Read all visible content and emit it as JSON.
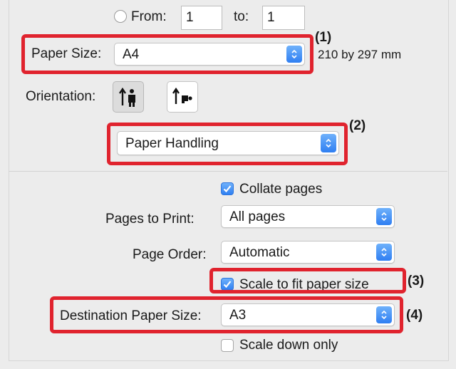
{
  "range": {
    "from_label": "From:",
    "from_value": "1",
    "to_label": "to:",
    "to_value": "1"
  },
  "paper_size": {
    "label": "Paper Size:",
    "value": "A4",
    "dimensions": "210 by 297 mm"
  },
  "orientation": {
    "label": "Orientation:",
    "selected": "portrait",
    "options": [
      "portrait",
      "landscape"
    ]
  },
  "section_menu": {
    "value": "Paper Handling"
  },
  "collate": {
    "label": "Collate pages",
    "checked": true
  },
  "pages_to_print": {
    "label": "Pages to Print:",
    "value": "All pages"
  },
  "page_order": {
    "label": "Page Order:",
    "value": "Automatic"
  },
  "scale_to_fit": {
    "label": "Scale to fit paper size",
    "checked": true
  },
  "destination": {
    "label": "Destination Paper Size:",
    "value": "A3"
  },
  "scale_down": {
    "label": "Scale down only",
    "checked": false
  },
  "callouts": [
    "(1)",
    "(2)",
    "(3)",
    "(4)"
  ],
  "colors": {
    "accent": "#2f7ff2",
    "highlight": "#e0232e",
    "background": "#ececec"
  }
}
